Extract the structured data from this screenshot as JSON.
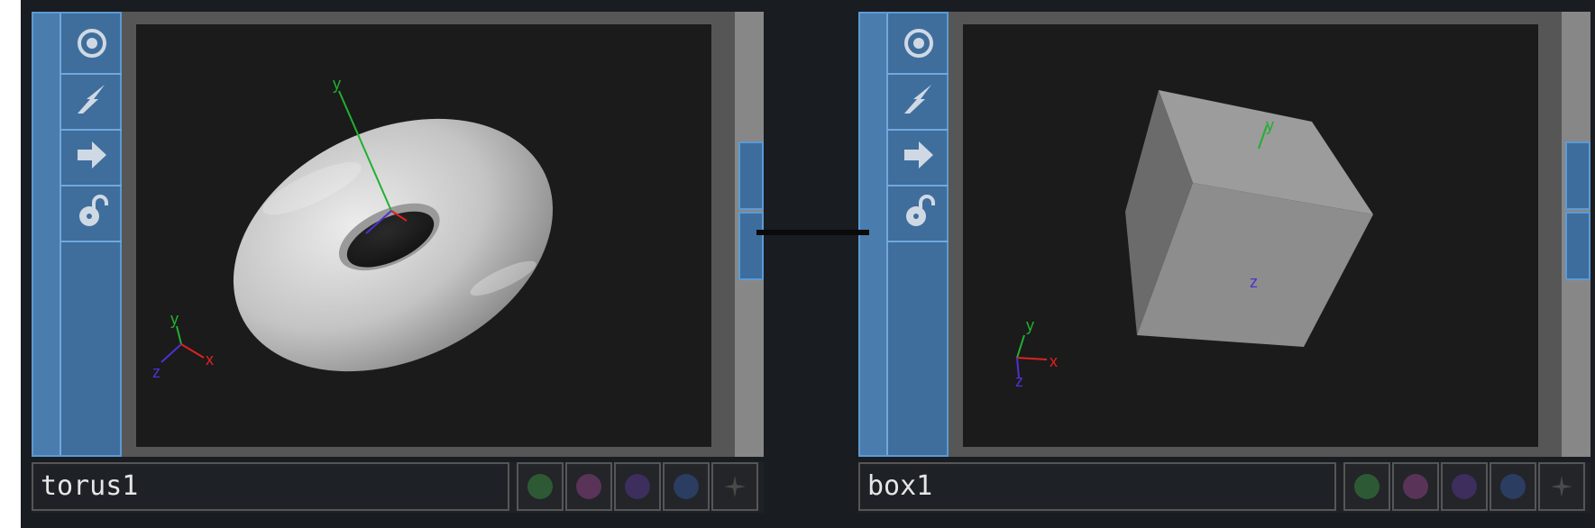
{
  "nodes": [
    {
      "name": "torus1",
      "viewer_shape": "torus",
      "flags": [
        "viewer-active-icon",
        "cooking-icon",
        "bypass-arrow-icon",
        "lock-icon"
      ],
      "axis_labels": {
        "x": "x",
        "y": "y",
        "z": "z"
      },
      "buttons": [
        {
          "icon": "green-dot-icon",
          "color": "#2d5a35"
        },
        {
          "icon": "pink-dot-icon",
          "color": "#5a3358"
        },
        {
          "icon": "purple-dot-icon",
          "color": "#3d2e5e"
        },
        {
          "icon": "blue-dot-icon",
          "color": "#2b3d60"
        },
        {
          "icon": "plus-icon",
          "color": "#4a4a4a"
        }
      ]
    },
    {
      "name": "box1",
      "viewer_shape": "box",
      "flags": [
        "viewer-active-icon",
        "cooking-icon",
        "bypass-arrow-icon",
        "lock-icon"
      ],
      "axis_labels": {
        "x": "x",
        "y": "y",
        "z": "z"
      },
      "buttons": [
        {
          "icon": "green-dot-icon",
          "color": "#2d5a35"
        },
        {
          "icon": "pink-dot-icon",
          "color": "#5a3358"
        },
        {
          "icon": "purple-dot-icon",
          "color": "#3d2e5e"
        },
        {
          "icon": "blue-dot-icon",
          "color": "#2b3d60"
        },
        {
          "icon": "plus-icon",
          "color": "#4a4a4a"
        }
      ]
    }
  ],
  "colors": {
    "accent": "#4a7cad",
    "axis_x": "#e02020",
    "axis_y": "#20b030",
    "axis_z": "#5030d0"
  }
}
